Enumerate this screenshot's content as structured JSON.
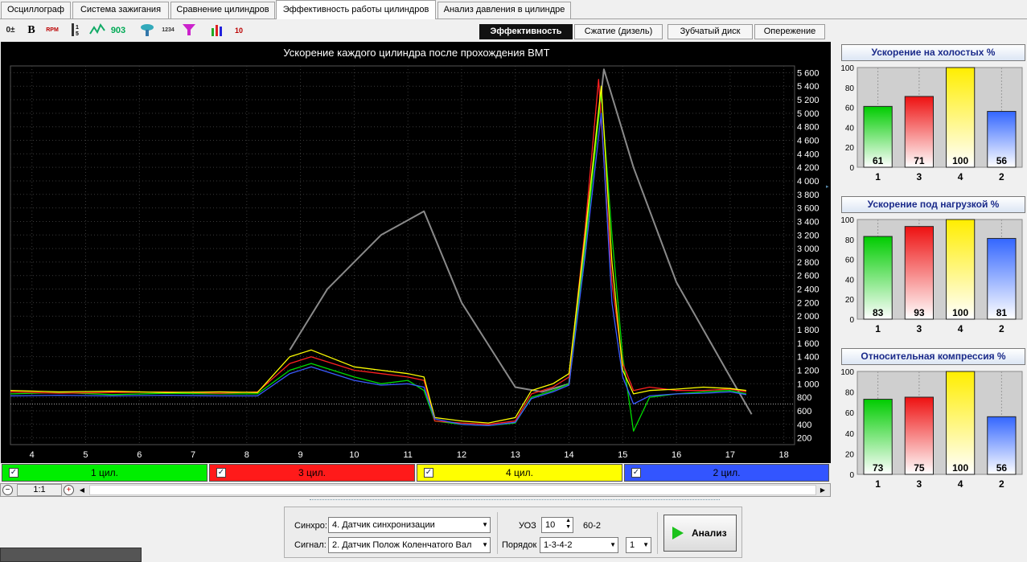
{
  "tabs": [
    "Осциллограф",
    "Система зажигания",
    "Сравнение цилиндров",
    "Эффективность работы цилиндров",
    "Анализ давления в цилиндре"
  ],
  "toolbar": {
    "icons": [
      "zero-adjust-icon",
      "bold-b-icon",
      "rpm-icon",
      "scale-icon",
      "wave-icon",
      "yo3-icon",
      "filter-icon",
      "index-icon",
      "funnel-icon",
      "bar-chart-icon",
      "export-icon"
    ],
    "labels": {
      "zero": "0±",
      "b": "B",
      "rpm": "RPM",
      "yo3": "903",
      "idx": "1234",
      "ten": "10"
    }
  },
  "modes": [
    "Эффективность",
    "Сжатие (дизель)",
    "Зубчатый диск",
    "Опережение"
  ],
  "chart": {
    "title": "Ускорение каждого цилиндра после прохождения ВМТ"
  },
  "colors": {
    "c1": "#00dd00",
    "c3": "#ff2020",
    "c4": "#ffff00",
    "c2": "#3b5bff",
    "gray": "#8a8a8a"
  },
  "chart_data": {
    "type": "line",
    "title": "Ускорение каждого цилиндра после прохождения ВМТ",
    "xlim": [
      3.6,
      18.2
    ],
    "ylim": [
      100,
      5700
    ],
    "x_ticks": [
      4,
      5,
      6,
      7,
      8,
      9,
      10,
      11,
      12,
      13,
      14,
      15,
      16,
      17,
      18
    ],
    "y_ticks": [
      200,
      400,
      600,
      800,
      1000,
      1200,
      1400,
      1600,
      1800,
      2000,
      2200,
      2400,
      2600,
      2800,
      3000,
      3200,
      3400,
      3600,
      3800,
      4000,
      4200,
      4400,
      4600,
      4800,
      5000,
      5200,
      5400,
      5600
    ],
    "y_tick_labels": [
      "200",
      "400",
      "600",
      "800",
      "1 000",
      "1 200",
      "1 400",
      "1 600",
      "1 800",
      "2 000",
      "2 200",
      "2 400",
      "2 600",
      "2 800",
      "3 000",
      "3 200",
      "3 400",
      "3 600",
      "3 800",
      "4 000",
      "4 200",
      "4 400",
      "4 600",
      "4 800",
      "5 000",
      "5 200",
      "5 400",
      "5 600"
    ],
    "reference_line_y": 700,
    "series": [
      {
        "name": "1 цил.",
        "color": "#00dd00",
        "x": [
          3.6,
          4.5,
          5.5,
          6.5,
          7.5,
          8.2,
          8.8,
          9.2,
          10,
          10.5,
          11,
          11.3,
          11.5,
          12,
          12.5,
          13,
          13.3,
          13.7,
          14,
          14.3,
          14.6,
          14.8,
          15,
          15.2,
          15.5,
          16,
          16.5,
          17,
          17.3
        ],
        "y": [
          850,
          870,
          840,
          860,
          850,
          850,
          1200,
          1300,
          1100,
          1000,
          1050,
          900,
          450,
          400,
          380,
          420,
          800,
          900,
          1000,
          3000,
          5300,
          3200,
          1400,
          300,
          800,
          850,
          880,
          900,
          850
        ]
      },
      {
        "name": "3 цил.",
        "color": "#ff2020",
        "x": [
          3.6,
          4.5,
          5.5,
          6.5,
          7.5,
          8.2,
          8.8,
          9.2,
          10,
          10.5,
          11,
          11.3,
          11.5,
          12,
          12.5,
          13,
          13.3,
          13.7,
          14,
          14.3,
          14.55,
          14.8,
          15,
          15.2,
          15.5,
          16,
          16.5,
          17,
          17.3
        ],
        "y": [
          880,
          860,
          870,
          880,
          860,
          880,
          1300,
          1400,
          1200,
          1150,
          1100,
          1050,
          450,
          420,
          400,
          450,
          850,
          950,
          1100,
          3300,
          5500,
          2500,
          1300,
          900,
          950,
          900,
          900,
          920,
          880
        ]
      },
      {
        "name": "4 цил.",
        "color": "#ffff00",
        "x": [
          3.6,
          4.5,
          5.5,
          6.5,
          7.5,
          8.2,
          8.8,
          9.2,
          10,
          10.5,
          11,
          11.3,
          11.5,
          12,
          12.5,
          13,
          13.3,
          13.7,
          14,
          14.3,
          14.6,
          14.8,
          15,
          15.2,
          15.5,
          16,
          16.5,
          17,
          17.3
        ],
        "y": [
          900,
          880,
          890,
          870,
          880,
          870,
          1400,
          1500,
          1250,
          1200,
          1150,
          1100,
          500,
          450,
          420,
          500,
          900,
          1000,
          1150,
          3200,
          5400,
          2800,
          1200,
          850,
          900,
          920,
          950,
          930,
          900
        ]
      },
      {
        "name": "2 цил.",
        "color": "#3b5bff",
        "x": [
          3.6,
          4.5,
          5.5,
          6.5,
          7.5,
          8.2,
          8.8,
          9.2,
          10,
          10.5,
          11,
          11.3,
          11.5,
          12,
          12.5,
          13,
          13.3,
          13.7,
          14,
          14.3,
          14.6,
          14.8,
          15,
          15.2,
          15.5,
          16,
          16.5,
          17,
          17.3
        ],
        "y": [
          820,
          830,
          820,
          830,
          820,
          820,
          1150,
          1250,
          1050,
          980,
          1000,
          950,
          480,
          400,
          380,
          430,
          780,
          880,
          980,
          2900,
          5000,
          2200,
          1100,
          700,
          820,
          850,
          860,
          880,
          840
        ]
      },
      {
        "name": "RPM",
        "color": "#8a8a8a",
        "x": [
          8.8,
          9.5,
          10.5,
          11.3,
          12,
          13,
          13.5,
          14,
          14.65,
          15.2,
          16,
          17,
          17.4
        ],
        "y": [
          1500,
          2400,
          3200,
          3550,
          2200,
          950,
          880,
          1000,
          5650,
          4200,
          2500,
          1100,
          550
        ]
      }
    ]
  },
  "legend": {
    "items": [
      {
        "label": "1 цил.",
        "bg": "#00ee00"
      },
      {
        "label": "3 цил.",
        "bg": "#ff1a1a"
      },
      {
        "label": "4 цил.",
        "bg": "#ffff00"
      },
      {
        "label": "2 цил.",
        "bg": "#3355ff"
      }
    ],
    "check": "✓"
  },
  "scroll": {
    "zoom": "1:1"
  },
  "panels": [
    {
      "title": "Ускорение на холостых %",
      "categories": [
        "1",
        "3",
        "4",
        "2"
      ],
      "values": [
        61,
        71,
        100,
        56
      ],
      "yticks": [
        0,
        20,
        40,
        60,
        80,
        100
      ]
    },
    {
      "title": "Ускорение под нагрузкой %",
      "categories": [
        "1",
        "3",
        "4",
        "2"
      ],
      "values": [
        83,
        93,
        100,
        81
      ],
      "yticks": [
        0,
        20,
        40,
        60,
        80,
        100
      ]
    },
    {
      "title": "Относительная компрессия %",
      "categories": [
        "1",
        "3",
        "4",
        "2"
      ],
      "values": [
        73,
        75,
        100,
        56
      ],
      "yticks": [
        0,
        20,
        40,
        60,
        80,
        100
      ]
    }
  ],
  "bar_colors": [
    "#00cc00",
    "#ee1111",
    "#ffee00",
    "#3366ff"
  ],
  "bottom": {
    "sync_label": "Синхро:",
    "sync_value": "4.  Датчик синхронизации",
    "signal_label": "Сигнал:",
    "signal_value": "2.  Датчик Полож Коленчатого Вал",
    "uoz_label": "УОЗ",
    "uoz_value": "10",
    "teeth": "60-2",
    "order_label": "Порядок",
    "order_value": "1-3-4-2",
    "order_num": "1",
    "analyze_label": "Анализ"
  }
}
